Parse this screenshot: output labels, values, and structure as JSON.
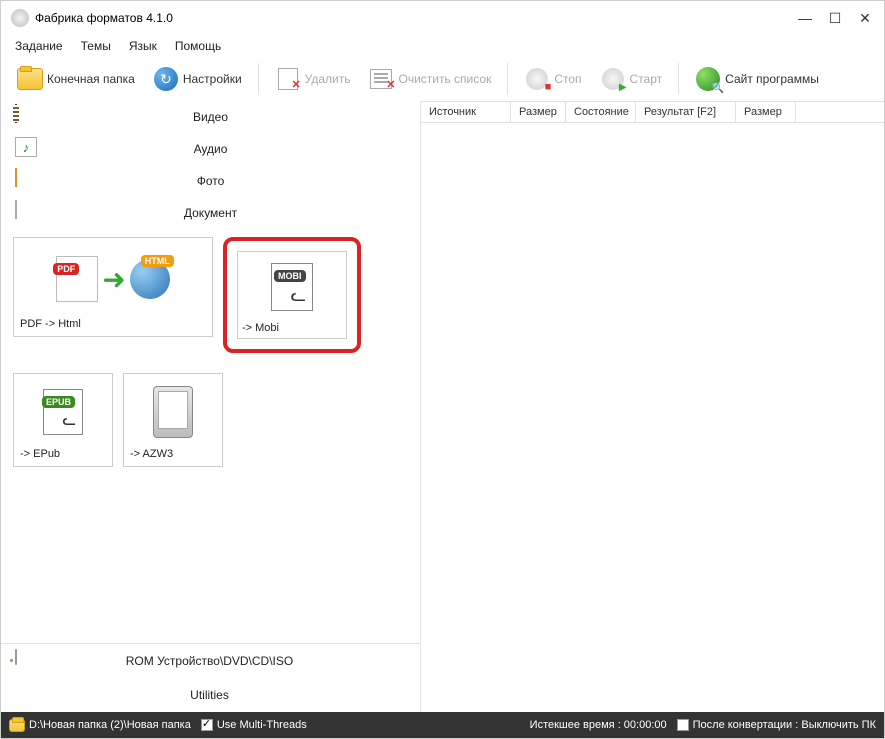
{
  "title": "Фабрика форматов 4.1.0",
  "menu": {
    "task": "Задание",
    "themes": "Темы",
    "lang": "Язык",
    "help": "Помощь"
  },
  "toolbar": {
    "output_folder": "Конечная папка",
    "settings": "Настройки",
    "remove": "Удалить",
    "clear": "Очистить список",
    "stop": "Стоп",
    "start": "Старт",
    "site": "Сайт программы"
  },
  "categories": {
    "video": "Видео",
    "audio": "Аудио",
    "photo": "Фото",
    "document": "Документ"
  },
  "tiles": {
    "pdf_html": "PDF -> Html",
    "mobi": "-> Mobi",
    "epub": "-> EPub",
    "azw3": "-> AZW3"
  },
  "badges": {
    "pdf": "PDF",
    "html": "HTML",
    "mobi": "MOBI",
    "epub": "EPUB"
  },
  "bottom": {
    "rom": "ROM Устройство\\DVD\\CD\\ISO",
    "util": "Utilities"
  },
  "table": {
    "source": "Источник",
    "size": "Размер",
    "state": "Состояние",
    "result": "Результат [F2]",
    "size2": "Размер"
  },
  "status": {
    "path": "D:\\Новая папка (2)\\Новая папка",
    "multi": "Use Multi-Threads",
    "elapsed": "Истекшее время : 00:00:00",
    "after": "После конвертации : Выключить ПК"
  }
}
